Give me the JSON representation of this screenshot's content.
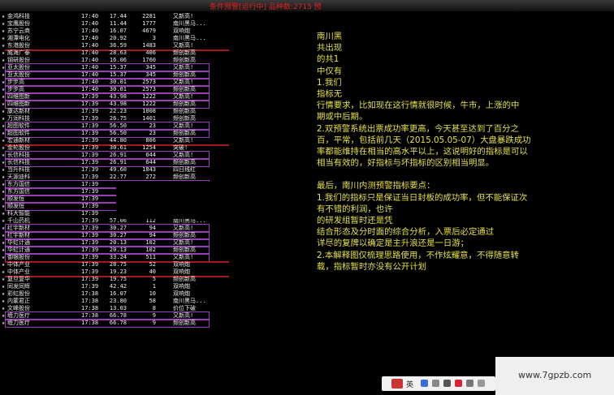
{
  "window": {
    "title": "条件预警[运行中] 品种数:2715 预"
  },
  "columns": [
    "name",
    "time",
    "price",
    "volume",
    "status"
  ],
  "rows": [
    [
      "金鸿科技",
      "17:40",
      "17.44",
      "2281",
      "又新高!"
    ],
    [
      "宝鹰股份",
      "17:40",
      "11.44",
      "1777",
      "南川黑马..."
    ],
    [
      "苏宁云商",
      "17:40",
      "16.07",
      "4679",
      "双响炮"
    ],
    [
      "湘潭电化",
      "17:40",
      "20.92",
      "3",
      "南川黑马..."
    ],
    [
      "东港股份",
      "17:40",
      "36.59",
      "1483",
      "又新高!"
    ],
    [
      "威海广泰",
      "17:40",
      "28.63",
      "406",
      "频创新高"
    ],
    [
      "钢研股份",
      "17:40",
      "16.06",
      "1760",
      "频创新高"
    ],
    [
      "亚太股份",
      "17:40",
      "15.37",
      "345",
      "又新高!"
    ],
    [
      "亚太股份",
      "17:40",
      "15.37",
      "345",
      "频创新高"
    ],
    [
      "步步高",
      "17:40",
      "30.01",
      "2573",
      "又新高!"
    ],
    [
      "步步高",
      "17:40",
      "30.01",
      "2573",
      "频创新高"
    ],
    [
      "四维图新",
      "17:39",
      "43.98",
      "1222",
      "又新高!"
    ],
    [
      "四维图新",
      "17:39",
      "43.98",
      "1222",
      "频创新高"
    ],
    [
      "康达新材",
      "17:39",
      "22.23",
      "1008",
      "频创新高"
    ],
    [
      "万润科技",
      "17:39",
      "26.75",
      "1401",
      "频创新高"
    ],
    [
      "超图软件",
      "17:39",
      "56.50",
      "23",
      "又新高!"
    ],
    [
      "超图软件",
      "17:39",
      "56.50",
      "23",
      "频创新高"
    ],
    [
      "宏通新材",
      "17:39",
      "44.80",
      "806",
      "又新高!"
    ],
    [
      "金轮股份",
      "17:39",
      "30.61",
      "1254",
      "突破!"
    ],
    [
      "长信科技",
      "17:39",
      "26.91",
      "644",
      "又新高!"
    ],
    [
      "长信科技",
      "17:39",
      "26.91",
      "644",
      "频创新高"
    ],
    [
      "当升科技",
      "17:39",
      "49.60",
      "1843",
      "四日线红"
    ],
    [
      "天源迪科",
      "17:39",
      "22.77",
      "272",
      "频创新高"
    ],
    [
      "东方国信",
      "17:39",
      "33",
      "",
      ""
    ],
    [
      "东方国信",
      "17:39",
      "33",
      "",
      ""
    ],
    [
      "顺发恒",
      "17:39",
      "",
      "",
      ""
    ],
    [
      "顺发恒",
      "17:39",
      "",
      "",
      ""
    ],
    [
      "科大智能",
      "17:39",
      "33.",
      "",
      ""
    ],
    [
      "千山药机",
      "17:39",
      "57.06",
      "112",
      "南川黑马..."
    ],
    [
      "红宇新材",
      "17:39",
      "30.27",
      "94",
      "又新高!"
    ],
    [
      "红宇新材",
      "17:39",
      "30.27",
      "94",
      "频创新高"
    ],
    [
      "华虹计通",
      "17:39",
      "20.13",
      "102",
      "又新高!"
    ],
    [
      "华虹计通",
      "17:39",
      "20.13",
      "102",
      "频创新高"
    ],
    [
      "御银股份",
      "17:39",
      "33.24",
      "511",
      "又新高!"
    ],
    [
      "中体产业",
      "17:39",
      "28.75",
      "52",
      "双响炮"
    ],
    [
      "中体产业",
      "17:39",
      "19.23",
      "40",
      "双响炮"
    ],
    [
      "复旦复华",
      "17:39",
      "19.75",
      "5",
      "频创新高"
    ],
    [
      "同发同辉",
      "17:39",
      "42.42",
      "1",
      "双响炮"
    ],
    [
      "彩虹股份",
      "17:38",
      "16.07",
      "10",
      "双响炮"
    ],
    [
      "内蒙君正",
      "17:38",
      "23.80",
      "58",
      "南川黑马..."
    ],
    [
      "文峰股份",
      "17:38",
      "13.03",
      "8",
      "价位下破"
    ],
    [
      "缠力医疗",
      "17:38",
      "66.78",
      "9",
      "又新高!"
    ],
    [
      "缠力医疗",
      "17:38",
      "66.78",
      "9",
      "频创新高"
    ]
  ],
  "notes": {
    "lines": [
      "南川黑",
      "共出现",
      "的共1",
      "中仅有",
      "1.我们",
      "指标无",
      "行情要求，比如现在这行情就很时候，牛市，上涨的中",
      "期或中后期。",
      "2.双预警系统出票成功率更高，今天甚至达到了百分之",
      "百，平常，包括前几天（2015.05.05-07）大盘暴跌成功",
      "率都能维持在相当的高水平以上，这说明好的指标是可以",
      "相当有效的，好指标与坏指标的区别相当明显。",
      "",
      "最后，南川内测预警指标要点：",
      "1.我们的指标只是保证当日封板的成功率，但不能保证次",
      "有不错的利润，也许",
      "的研发组暂时还是凭",
      "结合形态及分时面的综合分析，入票后必定通过",
      "详尽的复牌以确定是主升浪还是一日游；",
      "2.本解释图仅梳理思路使用，不作炫耀意，不得随意转",
      "载，指标暂时亦没有公开计划"
    ]
  },
  "watermark": {
    "text": "www.7gpzb.com"
  },
  "taskbar": {
    "ime_label": "英"
  },
  "colors": {
    "notes_text": "#e7e042",
    "box_border": "#9b3db5",
    "red_line": "#a51a1a"
  }
}
